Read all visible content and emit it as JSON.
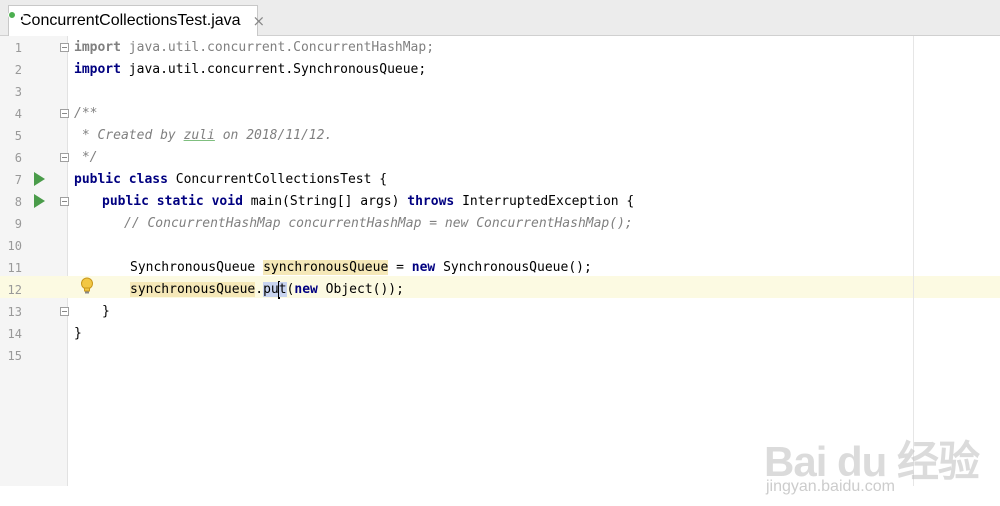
{
  "tab": {
    "title": "ConcurrentCollectionsTest.java",
    "close": "×",
    "icon": "java-class-icon"
  },
  "line_numbers": [
    "1",
    "2",
    "3",
    "4",
    "5",
    "6",
    "7",
    "8",
    "9",
    "10",
    "11",
    "12",
    "13",
    "14",
    "15"
  ],
  "code": {
    "l1_kw": "import",
    "l1_rest": " java.util.concurrent.ConcurrentHashMap;",
    "l2_kw": "import",
    "l2_rest": " java.util.concurrent.SynchronousQueue;",
    "l4": "/**",
    "l5_a": " * Created by ",
    "l5_b": "zuli",
    "l5_c": " on 2018/11/12.",
    "l6": " */",
    "l7_kw1": "public",
    "l7_kw2": "class",
    "l7_rest": " ConcurrentCollectionsTest {",
    "l8_kw1": "public",
    "l8_kw2": "static",
    "l8_kw3": "void",
    "l8_mid": " main(String[] args) ",
    "l8_kw4": "throws",
    "l8_rest": " InterruptedException {",
    "l9": "// ConcurrentHashMap concurrentHashMap = new ConcurrentHashMap();",
    "l11_a": "SynchronousQueue ",
    "l11_b": "synchronousQueue",
    "l11_c": " = ",
    "l11_kw": "new",
    "l11_d": " SynchronousQueue();",
    "l12_a": "synchronousQueue",
    "l12_b": ".",
    "l12_c1": "pu",
    "l12_c2": "t",
    "l12_d": "(",
    "l12_kw": "new",
    "l12_e": " Object());",
    "l13": "}",
    "l14": "}"
  },
  "watermark": {
    "brand": "Bai du 经验",
    "url": "jingyan.baidu.com"
  }
}
